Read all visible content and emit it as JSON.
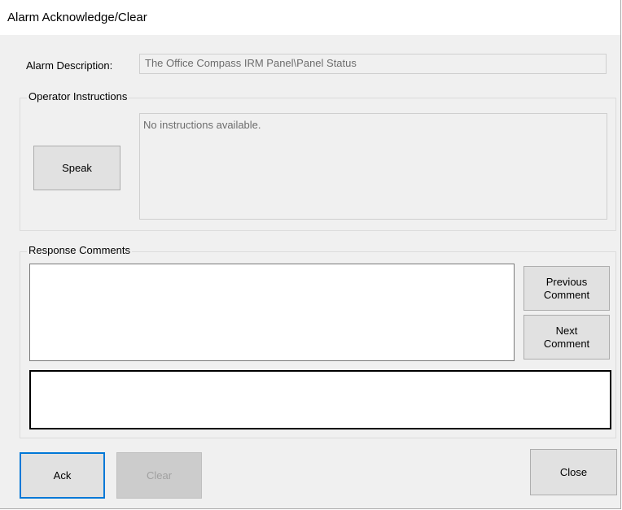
{
  "window": {
    "title": "Alarm Acknowledge/Clear"
  },
  "alarm": {
    "description_label": "Alarm Description:",
    "description_value": "The Office Compass IRM Panel\\Panel Status"
  },
  "operator_instructions": {
    "group_title": "Operator Instructions",
    "speak_label": "Speak",
    "instructions_text": "No instructions available."
  },
  "response_comments": {
    "group_title": "Response Comments",
    "previous_label": "Previous\nComment",
    "next_label": "Next\nComment",
    "comment_list_value": "",
    "comment_entry_value": ""
  },
  "footer": {
    "ack_label": "Ack",
    "clear_label": "Clear",
    "close_label": "Close"
  }
}
